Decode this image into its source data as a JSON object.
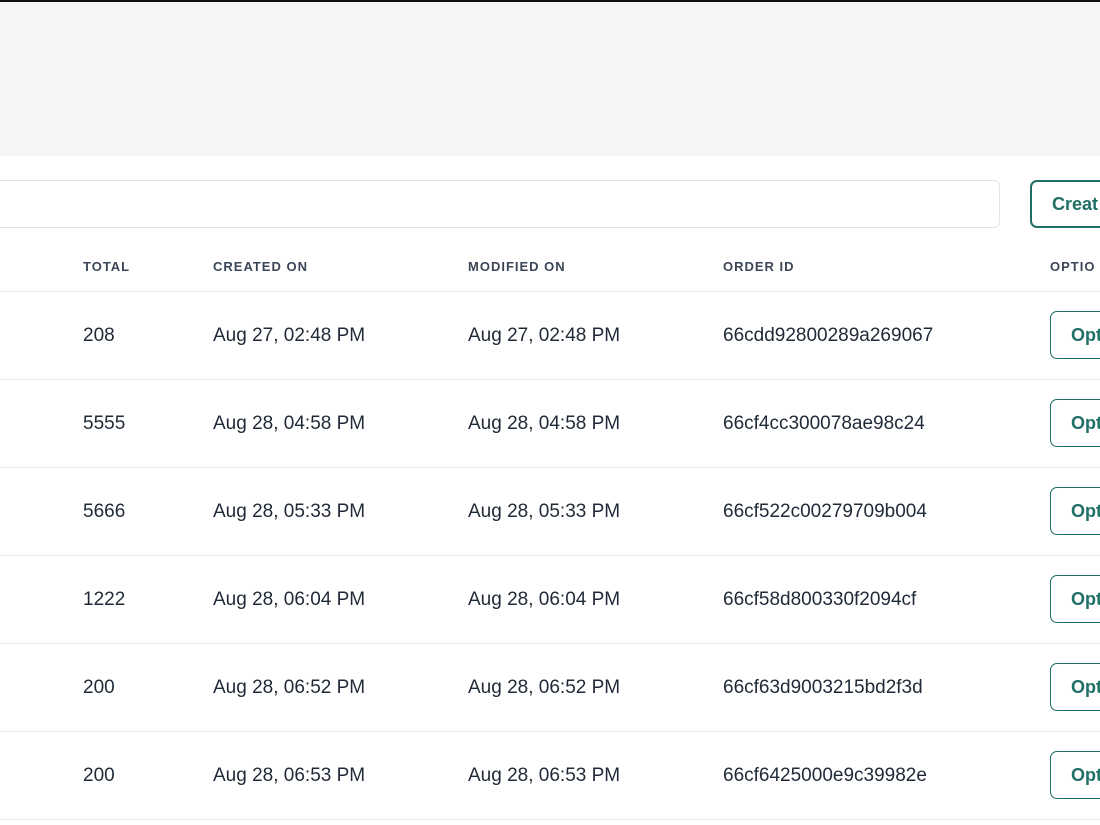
{
  "toolbar": {
    "create_label": "Creat"
  },
  "table": {
    "headers": {
      "total": "TOTAL",
      "created_on": "CREATED ON",
      "modified_on": "MODIFIED ON",
      "order_id": "ORDER ID",
      "options": "OPTIO"
    },
    "option_label": "Opt",
    "rows": [
      {
        "total": "208",
        "created_on": "Aug 27, 02:48 PM",
        "modified_on": "Aug 27, 02:48 PM",
        "order_id": "66cdd92800289a269067"
      },
      {
        "total": "5555",
        "created_on": "Aug 28, 04:58 PM",
        "modified_on": "Aug 28, 04:58 PM",
        "order_id": "66cf4cc300078ae98c24"
      },
      {
        "total": "5666",
        "created_on": "Aug 28, 05:33 PM",
        "modified_on": "Aug 28, 05:33 PM",
        "order_id": "66cf522c00279709b004"
      },
      {
        "total": "1222",
        "created_on": "Aug 28, 06:04 PM",
        "modified_on": "Aug 28, 06:04 PM",
        "order_id": "66cf58d800330f2094cf"
      },
      {
        "total": "200",
        "created_on": "Aug 28, 06:52 PM",
        "modified_on": "Aug 28, 06:52 PM",
        "order_id": "66cf63d9003215bd2f3d"
      },
      {
        "total": "200",
        "created_on": "Aug 28, 06:53 PM",
        "modified_on": "Aug 28, 06:53 PM",
        "order_id": "66cf6425000e9c39982e"
      }
    ]
  }
}
